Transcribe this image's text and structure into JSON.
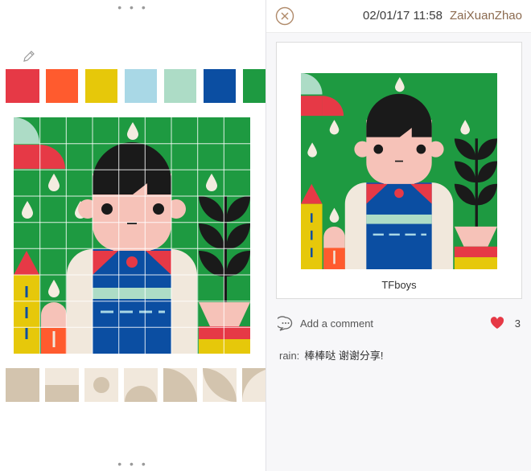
{
  "palette": {
    "colors": [
      "#e63946",
      "#ff5b2e",
      "#e6c80a",
      "#a9d8e6",
      "#addcc6",
      "#0b4ea2",
      "#1e9a41"
    ]
  },
  "header": {
    "date": "02/01/17 11:58",
    "username": "ZaiXuanZhao"
  },
  "post": {
    "title": "TFboys"
  },
  "actions": {
    "comment_label": "Add a comment",
    "likes": "3"
  },
  "comments": [
    {
      "author": "rain:",
      "text": "棒棒哒 谢谢分享!"
    }
  ],
  "icons": {
    "edit": "pencil-icon",
    "close": "close-icon",
    "comment": "speech-bubble-icon",
    "like": "heart-icon"
  }
}
